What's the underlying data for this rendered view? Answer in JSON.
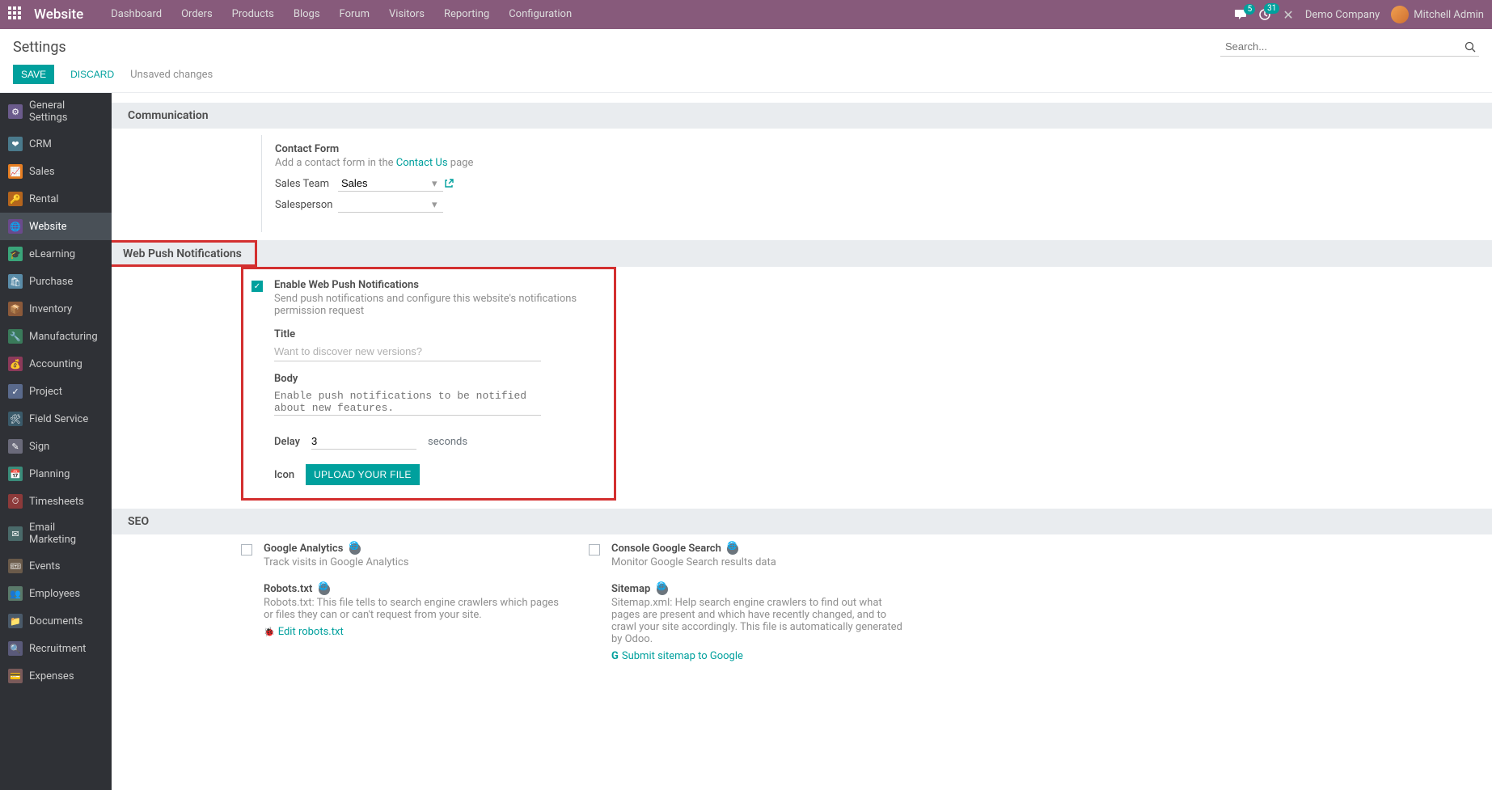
{
  "navbar": {
    "brand": "Website",
    "menu": [
      "Dashboard",
      "Orders",
      "Products",
      "Blogs",
      "Forum",
      "Visitors",
      "Reporting",
      "Configuration"
    ],
    "msg_badge": "5",
    "activity_badge": "31",
    "company": "Demo Company",
    "user": "Mitchell Admin"
  },
  "control": {
    "title": "Settings",
    "search_placeholder": "Search...",
    "save": "SAVE",
    "discard": "DISCARD",
    "unsaved": "Unsaved changes"
  },
  "sidebar": {
    "items": [
      {
        "label": "General Settings"
      },
      {
        "label": "CRM"
      },
      {
        "label": "Sales"
      },
      {
        "label": "Rental"
      },
      {
        "label": "Website"
      },
      {
        "label": "eLearning"
      },
      {
        "label": "Purchase"
      },
      {
        "label": "Inventory"
      },
      {
        "label": "Manufacturing"
      },
      {
        "label": "Accounting"
      },
      {
        "label": "Project"
      },
      {
        "label": "Field Service"
      },
      {
        "label": "Sign"
      },
      {
        "label": "Planning"
      },
      {
        "label": "Timesheets"
      },
      {
        "label": "Email Marketing"
      },
      {
        "label": "Events"
      },
      {
        "label": "Employees"
      },
      {
        "label": "Documents"
      },
      {
        "label": "Recruitment"
      },
      {
        "label": "Expenses"
      }
    ]
  },
  "comm": {
    "header": "Communication",
    "contact_title": "Contact Form",
    "contact_desc_pre": "Add a contact form in the ",
    "contact_link": "Contact Us",
    "contact_desc_post": " page",
    "sales_team_label": "Sales Team",
    "sales_team_value": "Sales",
    "salesperson_label": "Salesperson"
  },
  "push": {
    "header": "Web Push Notifications",
    "enable_title": "Enable Web Push Notifications",
    "enable_desc": "Send push notifications and configure this website's notifications permission request",
    "title_label": "Title",
    "title_placeholder": "Want to discover new versions?",
    "body_label": "Body",
    "body_placeholder": "Enable push notifications to be notified about new features.",
    "delay_label": "Delay",
    "delay_value": "3",
    "delay_suffix": "seconds",
    "icon_label": "Icon",
    "upload_btn": "UPLOAD YOUR FILE"
  },
  "seo": {
    "header": "SEO",
    "ga_title": "Google Analytics",
    "ga_desc": "Track visits in Google Analytics",
    "gsc_title": "Console Google Search",
    "gsc_desc": "Monitor Google Search results data",
    "robots_title": "Robots.txt",
    "robots_desc": "Robots.txt: This file tells to search engine crawlers which pages or files they can or can't request from your site.",
    "robots_link": "Edit robots.txt",
    "sitemap_title": "Sitemap",
    "sitemap_desc": "Sitemap.xml: Help search engine crawlers to find out what pages are present and which have recently changed, and to crawl your site accordingly. This file is automatically generated by Odoo.",
    "sitemap_link": "Submit sitemap to Google"
  }
}
